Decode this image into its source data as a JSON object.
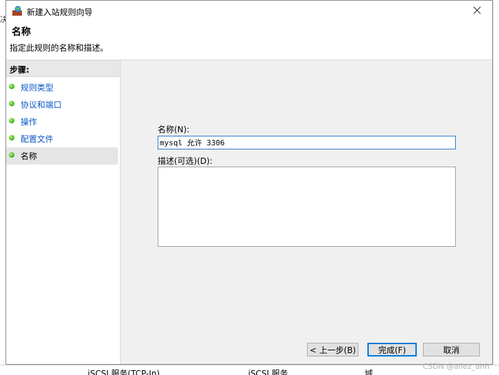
{
  "window": {
    "title": "新建入站规则向导"
  },
  "header": {
    "title": "名称",
    "description": "指定此规则的名称和描述。"
  },
  "steps": {
    "heading": "步骤:",
    "items": [
      {
        "label": "规则类型"
      },
      {
        "label": "协议和端口"
      },
      {
        "label": "操作"
      },
      {
        "label": "配置文件"
      },
      {
        "label": "名称",
        "current": true
      }
    ]
  },
  "form": {
    "name_label": "名称(N):",
    "name_value": "mysql 允许 3306",
    "description_label": "描述(可选)(D):",
    "description_value": ""
  },
  "buttons": {
    "back": "< 上一步(B)",
    "finish": "完成(F)",
    "cancel": "取消"
  },
  "background": {
    "row_col1": "iSCSI 服务(TCP-In)",
    "row_col2": "iSCSI 服务",
    "row_col3": "域",
    "left_glyph": "决"
  },
  "watermark": "CSDN @aliez_ahh"
}
